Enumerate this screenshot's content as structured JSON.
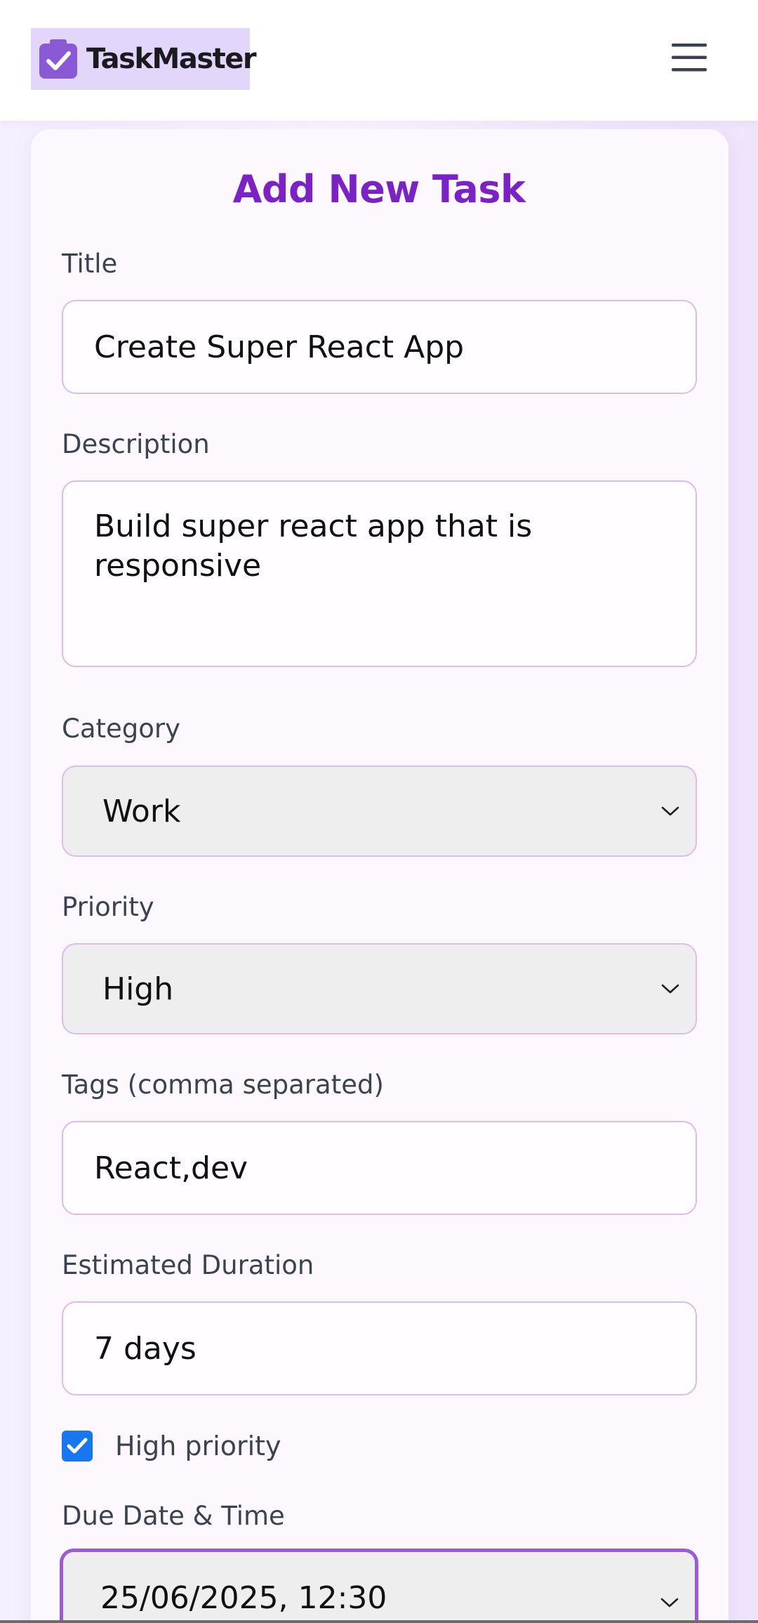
{
  "app": {
    "name": "TaskMaster",
    "logo_icon": "clipboard-check-icon",
    "menu_icon": "hamburger-menu-icon"
  },
  "form": {
    "title": "Add New Task",
    "title_field": {
      "label": "Title",
      "value": "Create Super React App"
    },
    "description": {
      "label": "Description",
      "value": "Build super react app that is responsive"
    },
    "category": {
      "label": "Category",
      "selected": "Work"
    },
    "priority": {
      "label": "Priority",
      "selected": "High"
    },
    "tags": {
      "label": "Tags (comma separated)",
      "value": "React,dev"
    },
    "estimated_duration": {
      "label": "Estimated Duration",
      "value": "7 days"
    },
    "high_priority": {
      "label": "High priority",
      "checked": true
    },
    "due_date": {
      "label": "Due Date & Time",
      "selected": "25/06/2025, 12:30"
    }
  },
  "colors": {
    "accent": "#7b22c7",
    "logo_bg": "#e3d6fb",
    "logo_icon": "#8a5ad6",
    "checkbox": "#1677f0",
    "field_border": "#dcbce8",
    "focus_border": "#9b5ad9"
  }
}
